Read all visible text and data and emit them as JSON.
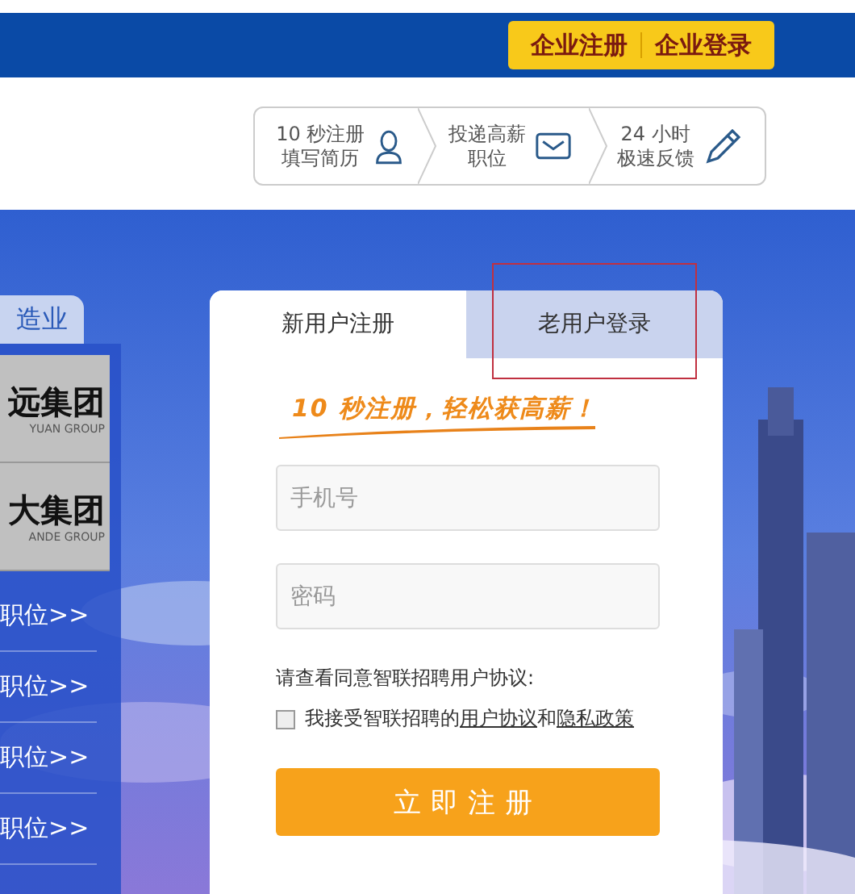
{
  "header": {
    "buttons": [
      {
        "label": "企业注册"
      },
      {
        "label": "企业登录"
      }
    ]
  },
  "steps": [
    {
      "lines": [
        "10 秒注册",
        "填写简历"
      ]
    },
    {
      "lines": [
        "投递高薪",
        "职位"
      ]
    },
    {
      "lines": [
        "24 小时",
        "极速反馈"
      ]
    }
  ],
  "sidebar": {
    "tab": "造业",
    "logos": [
      {
        "name": "远集团",
        "subtitle": "YUAN GROUP"
      },
      {
        "name": "大集团",
        "subtitle": "ANDE GROUP"
      }
    ],
    "links": [
      "职位>>",
      "职位>>",
      "职位>>",
      "职位>>"
    ]
  },
  "form": {
    "tabs": [
      {
        "label": "新用户注册",
        "selected": true,
        "highlighted": false
      },
      {
        "label": "老用户登录",
        "selected": false,
        "highlighted": true
      }
    ],
    "slogan": "10 秒注册，轻松获高薪！",
    "fields": [
      {
        "placeholder": "手机号"
      },
      {
        "placeholder": "密码"
      }
    ],
    "agreement": {
      "prompt": "请查看同意智联招聘用户协议:",
      "checked": false,
      "text": "我接受智联招聘的",
      "links": [
        "用户协议",
        "隐私政策"
      ],
      "joiner": "和"
    },
    "submit": "立即注册"
  }
}
